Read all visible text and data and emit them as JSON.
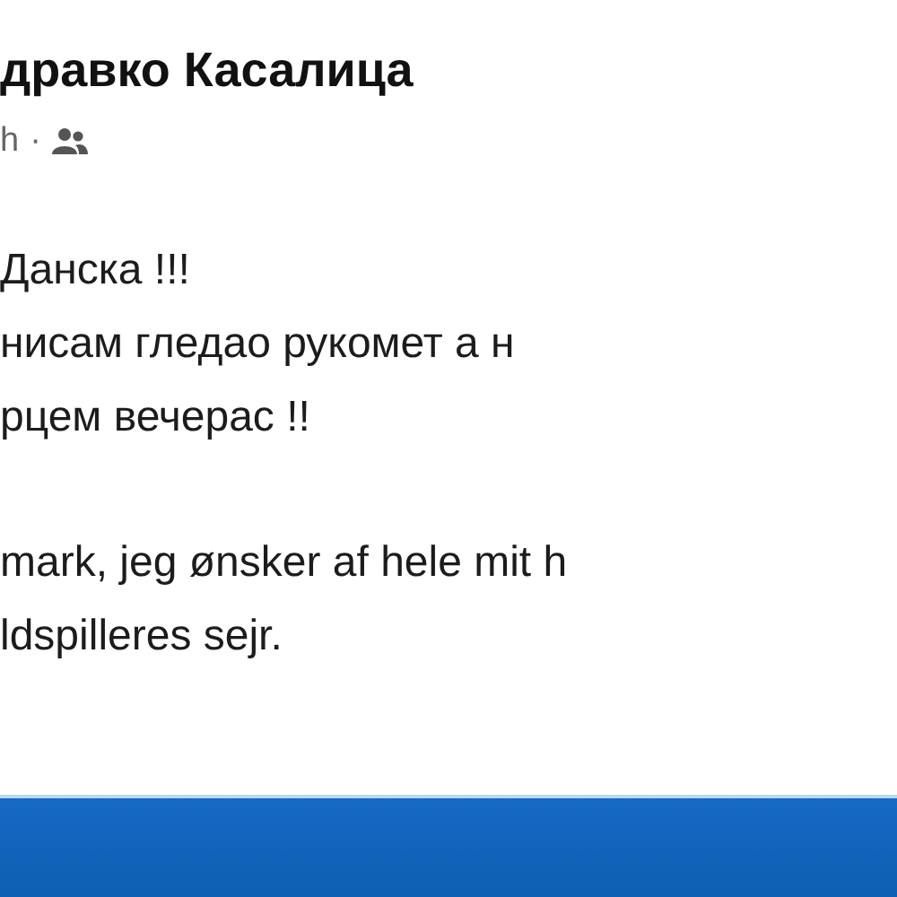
{
  "post": {
    "author": "дравко Касалица",
    "time": "h",
    "separator": "·",
    "paragraphs": [
      {
        "lines": [
          "Данска !!!",
          "нисам гледао рукомет а н",
          "рцем вечерас !!"
        ]
      },
      {
        "lines": [
          "mark, jeg ønsker af hele mit h",
          "ldspilleres sejr."
        ]
      }
    ]
  },
  "bottom_bar": {
    "kind": "bar"
  }
}
